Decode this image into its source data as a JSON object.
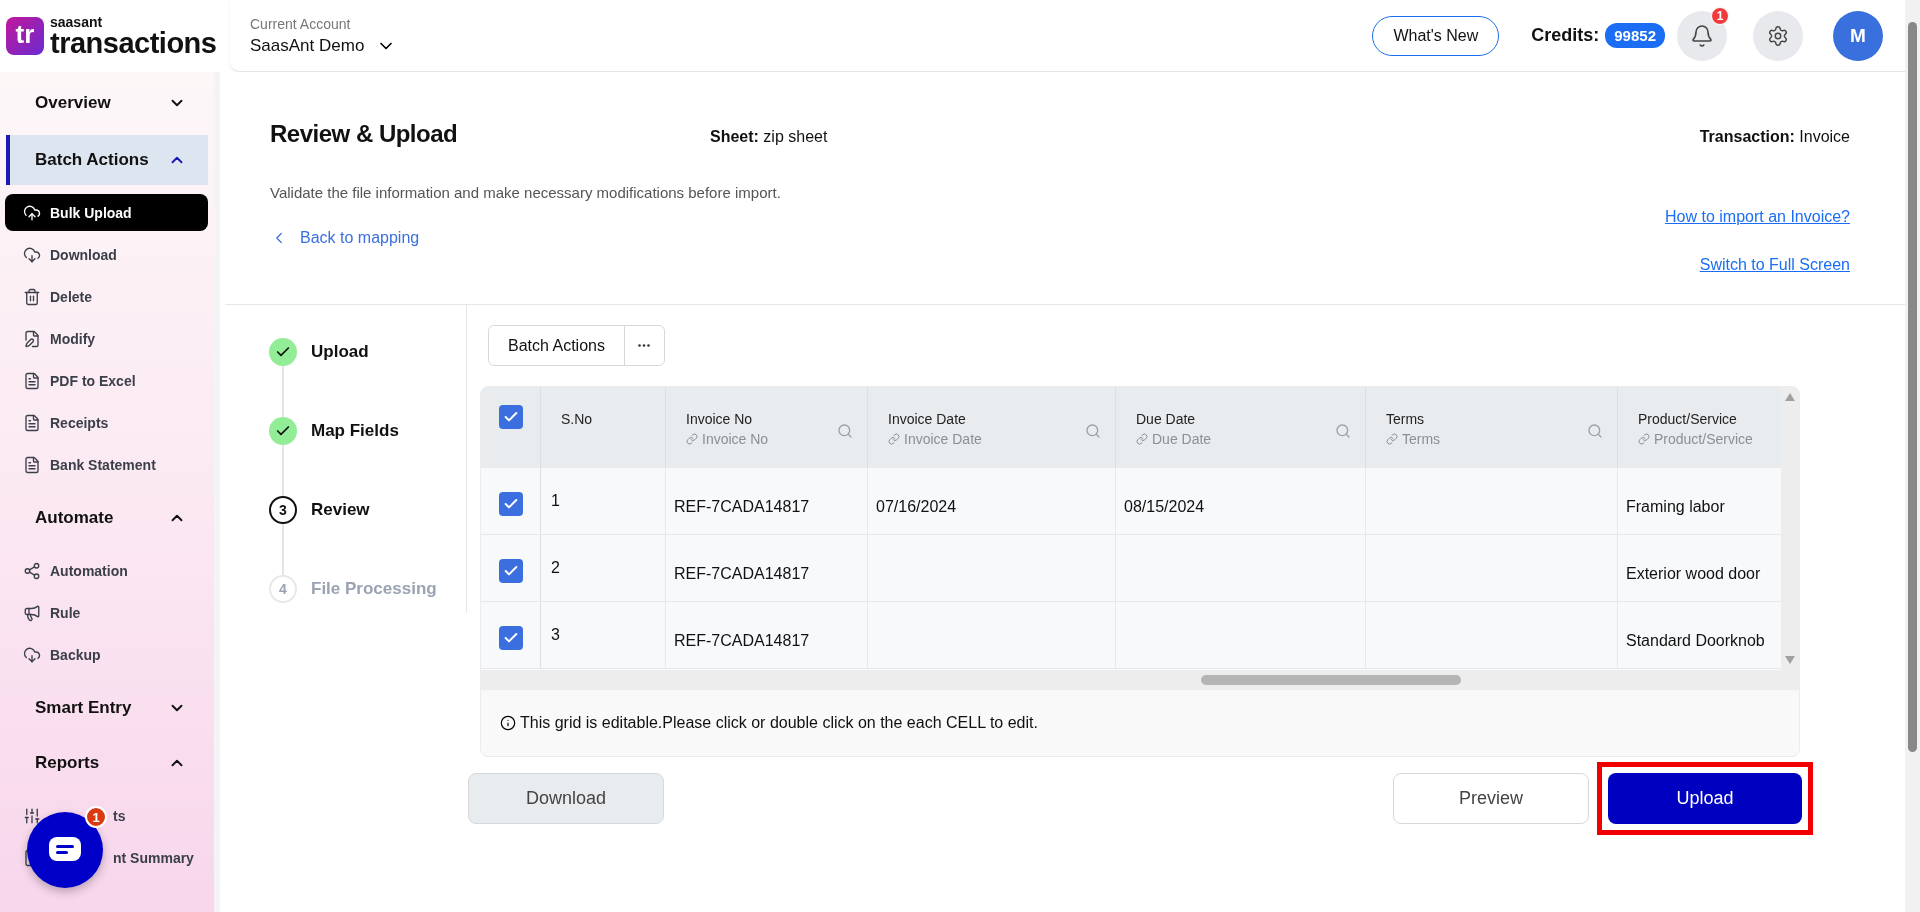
{
  "header": {
    "logo": {
      "mark": "tr",
      "brand": "saasant",
      "product": "transactions"
    },
    "account": {
      "label": "Current Account",
      "name": "SaasAnt Demo"
    },
    "whats_new": "What's New",
    "credits": {
      "label": "Credits:",
      "value": "99852"
    },
    "notifications": {
      "badge": "1"
    },
    "avatar": "M"
  },
  "sidebar": {
    "sections": [
      {
        "title": "Overview",
        "expanded": false,
        "selected": false
      },
      {
        "title": "Batch Actions",
        "expanded": true,
        "selected": true,
        "items": [
          {
            "label": "Bulk Upload",
            "selected": true
          },
          {
            "label": "Download",
            "selected": false
          },
          {
            "label": "Delete",
            "selected": false
          },
          {
            "label": "Modify",
            "selected": false
          },
          {
            "label": "PDF to Excel",
            "selected": false
          },
          {
            "label": "Receipts",
            "selected": false
          },
          {
            "label": "Bank Statement",
            "selected": false
          }
        ]
      },
      {
        "title": "Automate",
        "expanded": true,
        "selected": false,
        "items": [
          {
            "label": "Automation",
            "selected": false
          },
          {
            "label": "Rule",
            "selected": false
          },
          {
            "label": "Backup",
            "selected": false
          }
        ]
      },
      {
        "title": "Smart Entry",
        "expanded": false,
        "selected": false
      },
      {
        "title": "Reports",
        "expanded": true,
        "selected": false,
        "items": [
          {
            "label": "ts",
            "selected": false
          },
          {
            "label": "nt Summary",
            "selected": false
          }
        ]
      }
    ]
  },
  "page": {
    "title": "Review & Upload",
    "sheet": {
      "label": "Sheet:",
      "value": "zip sheet"
    },
    "transaction": {
      "label": "Transaction:",
      "value": "Invoice"
    },
    "description": "Validate the file information and make necessary modifications before import.",
    "back_link": "Back to mapping",
    "help_links": [
      "How to import an Invoice?",
      "Switch to Full Screen"
    ]
  },
  "steps": [
    {
      "label": "Upload",
      "completed": true,
      "current": false
    },
    {
      "label": "Map Fields",
      "completed": true,
      "current": false
    },
    {
      "label": "Review",
      "completed": false,
      "current": true,
      "number": "3"
    },
    {
      "label": "File Processing",
      "completed": false,
      "current": false,
      "number": "4"
    }
  ],
  "toolbar": {
    "batch_actions": "Batch Actions"
  },
  "table": {
    "select_all": true,
    "columns": [
      {
        "title": "S.No",
        "searchable": false
      },
      {
        "title": "Invoice No",
        "mapped": "Invoice No",
        "searchable": true
      },
      {
        "title": "Invoice Date",
        "mapped": "Invoice Date",
        "searchable": true
      },
      {
        "title": "Due Date",
        "mapped": "Due Date",
        "searchable": true
      },
      {
        "title": "Terms",
        "mapped": "Terms",
        "searchable": true
      },
      {
        "title": "Product/Service",
        "mapped": "Product/Service",
        "searchable": false
      }
    ],
    "rows": [
      {
        "checked": true,
        "cells": [
          "1",
          "REF-7CADA14817",
          "07/16/2024",
          "08/15/2024",
          null,
          "Framing labor"
        ]
      },
      {
        "checked": true,
        "cells": [
          "2",
          "REF-7CADA14817",
          null,
          null,
          null,
          "Exterior wood door"
        ]
      },
      {
        "checked": true,
        "cells": [
          "3",
          "REF-7CADA14817",
          null,
          null,
          null,
          "Standard Doorknob"
        ]
      }
    ],
    "note": "This grid is editable.Please click or double click on the each CELL to edit."
  },
  "buttons": {
    "download": "Download",
    "preview": "Preview",
    "upload": {
      "label": "Upload",
      "highlighted": true
    }
  },
  "chat": {
    "badge": "1"
  }
}
